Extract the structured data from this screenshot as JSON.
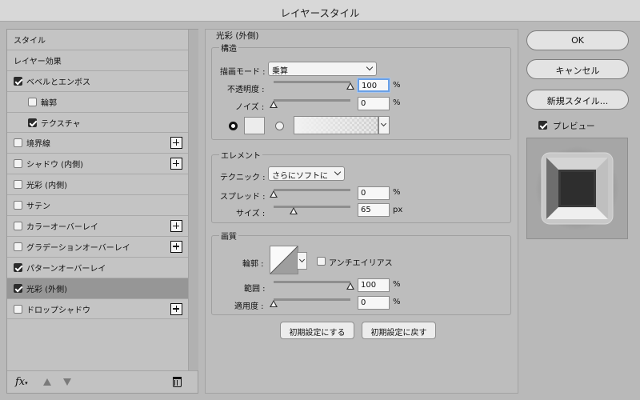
{
  "window": {
    "title": "レイヤースタイル"
  },
  "style_list": {
    "items": [
      {
        "label": "スタイル",
        "has_checkbox": false,
        "checked": false,
        "indent": false,
        "has_plus": false,
        "selected": false
      },
      {
        "label": "レイヤー効果",
        "has_checkbox": false,
        "checked": false,
        "indent": false,
        "has_plus": false,
        "selected": false
      },
      {
        "label": "ベベルとエンボス",
        "has_checkbox": true,
        "checked": true,
        "indent": false,
        "has_plus": false,
        "selected": false
      },
      {
        "label": "輪郭",
        "has_checkbox": true,
        "checked": false,
        "indent": true,
        "has_plus": false,
        "selected": false
      },
      {
        "label": "テクスチャ",
        "has_checkbox": true,
        "checked": true,
        "indent": true,
        "has_plus": false,
        "selected": false
      },
      {
        "label": "境界線",
        "has_checkbox": true,
        "checked": false,
        "indent": false,
        "has_plus": true,
        "selected": false
      },
      {
        "label": "シャドウ (内側)",
        "has_checkbox": true,
        "checked": false,
        "indent": false,
        "has_plus": true,
        "selected": false
      },
      {
        "label": "光彩 (内側)",
        "has_checkbox": true,
        "checked": false,
        "indent": false,
        "has_plus": false,
        "selected": false
      },
      {
        "label": "サテン",
        "has_checkbox": true,
        "checked": false,
        "indent": false,
        "has_plus": false,
        "selected": false
      },
      {
        "label": "カラーオーバーレイ",
        "has_checkbox": true,
        "checked": false,
        "indent": false,
        "has_plus": true,
        "selected": false
      },
      {
        "label": "グラデーションオーバーレイ",
        "has_checkbox": true,
        "checked": false,
        "indent": false,
        "has_plus": true,
        "selected": false
      },
      {
        "label": "パターンオーバーレイ",
        "has_checkbox": true,
        "checked": true,
        "indent": false,
        "has_plus": false,
        "selected": false
      },
      {
        "label": "光彩 (外側)",
        "has_checkbox": true,
        "checked": true,
        "indent": false,
        "has_plus": false,
        "selected": true
      },
      {
        "label": "ドロップシャドウ",
        "has_checkbox": true,
        "checked": false,
        "indent": false,
        "has_plus": true,
        "selected": false
      }
    ],
    "fx_label": "fx",
    "icons": [
      "fx-icon",
      "move-up-icon",
      "move-down-icon",
      "trash-icon"
    ]
  },
  "panel": {
    "title": "光彩 (外側)",
    "structure": {
      "title": "構造",
      "blend_mode_label": "描画モード :",
      "blend_mode_value": "乗算",
      "opacity_label": "不透明度 :",
      "opacity_value": "100",
      "opacity_unit": "%",
      "opacity_level": 1.0,
      "noise_label": "ノイズ :",
      "noise_value": "0",
      "noise_unit": "%",
      "noise_level": 0.0,
      "color_mode": "solid",
      "swatch_color": "#ececec"
    },
    "elements": {
      "title": "エレメント",
      "technique_label": "テクニック :",
      "technique_value": "さらにソフトに",
      "spread_label": "スプレッド :",
      "spread_value": "0",
      "spread_unit": "%",
      "spread_level": 0.0,
      "size_label": "サイズ :",
      "size_value": "65",
      "size_unit": "px",
      "size_level": 0.26
    },
    "quality": {
      "title": "画質",
      "contour_label": "輪郭 :",
      "anti_alias_label": "アンチエイリアス",
      "anti_alias_checked": false,
      "range_label": "範囲 :",
      "range_value": "100",
      "range_unit": "%",
      "range_level": 1.0,
      "jitter_label": "適用度 :",
      "jitter_value": "0",
      "jitter_unit": "%",
      "jitter_level": 0.0
    },
    "make_default_label": "初期設定にする",
    "reset_default_label": "初期設定に戻す"
  },
  "actions": {
    "ok_label": "OK",
    "cancel_label": "キャンセル",
    "new_style_label": "新規スタイル...",
    "preview_label": "プレビュー",
    "preview_checked": true
  }
}
